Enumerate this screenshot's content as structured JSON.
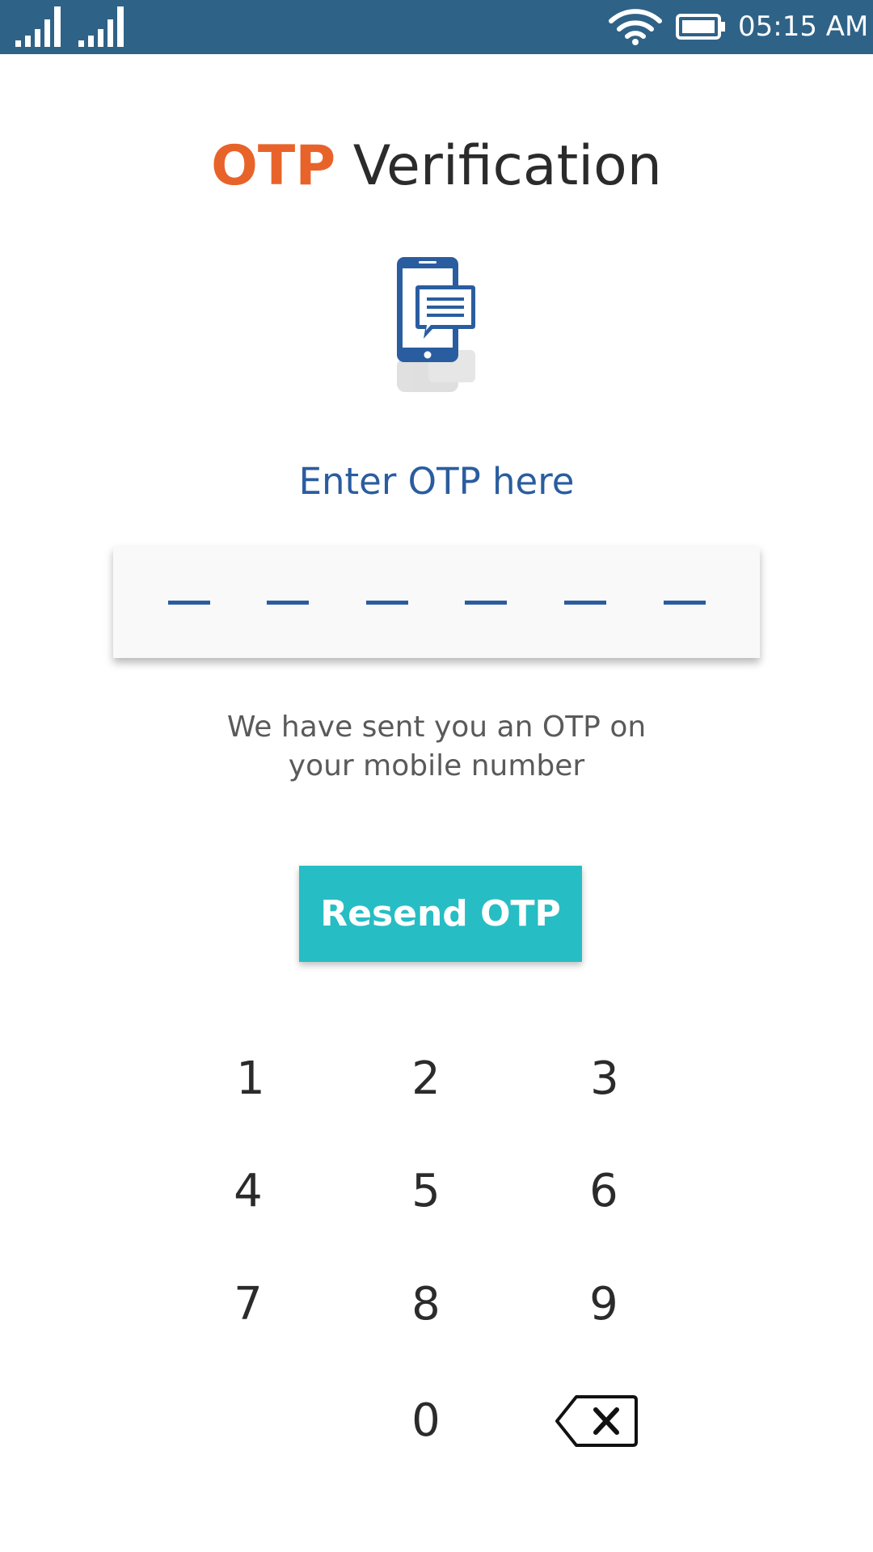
{
  "status_bar": {
    "time": "05:15 AM",
    "icons": [
      "signal-icon",
      "signal-icon",
      "wifi-icon",
      "battery-icon"
    ]
  },
  "header": {
    "title_accent": "OTP",
    "title_rest": "Verification"
  },
  "illustration": {
    "icon": "phone-message-icon"
  },
  "otp": {
    "prompt": "Enter OTP here",
    "length": 6,
    "note_line1": "We have sent you an OTP on",
    "note_line2": "your mobile number"
  },
  "actions": {
    "resend_label": "Resend OTP"
  },
  "keypad": {
    "keys": [
      "1",
      "2",
      "3",
      "4",
      "5",
      "6",
      "7",
      "8",
      "9",
      "0"
    ],
    "backspace_icon": "backspace-icon"
  },
  "colors": {
    "status_bar": "#2f6287",
    "accent_orange": "#e8632a",
    "primary_blue": "#2a5d9f",
    "button_teal": "#27bdc4"
  }
}
